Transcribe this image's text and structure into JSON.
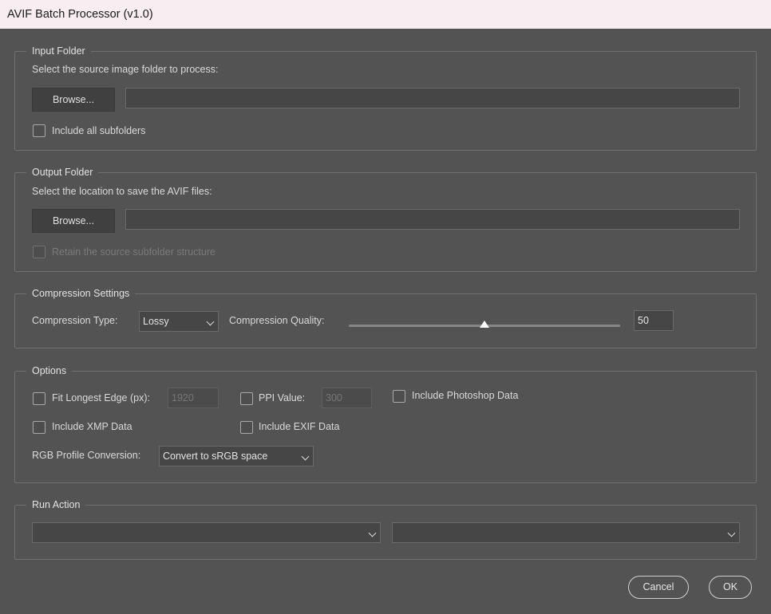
{
  "window": {
    "title": "AVIF Batch Processor (v1.0)"
  },
  "input_folder": {
    "legend": "Input Folder",
    "instruction": "Select the source image folder to process:",
    "browse_label": "Browse...",
    "path_value": "",
    "subfolders_label": "Include all subfolders",
    "subfolders_checked": false
  },
  "output_folder": {
    "legend": "Output Folder",
    "instruction": "Select the location to save the AVIF files:",
    "browse_label": "Browse...",
    "path_value": "",
    "retain_label": "Retain the source subfolder structure",
    "retain_checked": false,
    "retain_disabled": true
  },
  "compression": {
    "legend": "Compression Settings",
    "type_label": "Compression Type:",
    "type_value": "Lossy",
    "quality_label": "Compression Quality:",
    "quality_value": "50",
    "quality_fraction": 0.5
  },
  "options": {
    "legend": "Options",
    "fit_label": "Fit Longest Edge (px):",
    "fit_value": "1920",
    "ppi_label": "PPI Value:",
    "ppi_value": "300",
    "photoshop_label": "Include Photoshop Data",
    "xmp_label": "Include XMP Data",
    "exif_label": "Include EXIF Data",
    "rgb_label": "RGB Profile Conversion:",
    "rgb_value": "Convert to sRGB space"
  },
  "run_action": {
    "legend": "Run Action",
    "set_value": "",
    "action_value": ""
  },
  "footer": {
    "cancel_label": "Cancel",
    "ok_label": "OK"
  }
}
